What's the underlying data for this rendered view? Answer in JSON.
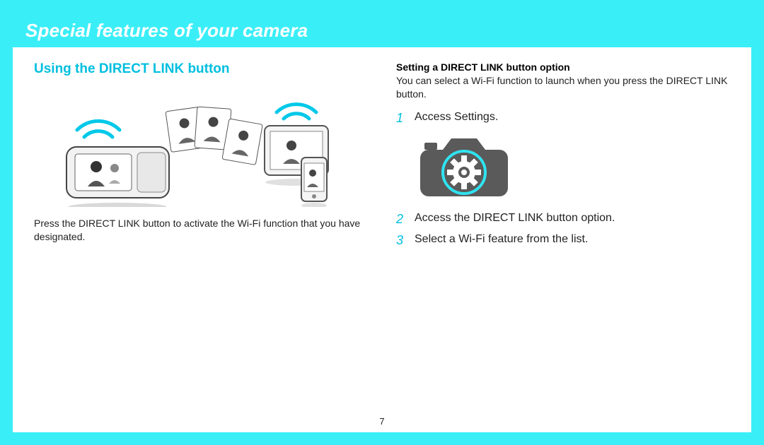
{
  "header": {
    "title": "Special features of your camera"
  },
  "left": {
    "heading": "Using the DIRECT LINK button",
    "paragraph": "Press the DIRECT LINK button to activate the Wi-Fi function that you have designated."
  },
  "right": {
    "subheading": "Setting a DIRECT LINK button option",
    "paragraph": "You can select a Wi-Fi function to launch when you press the DIRECT LINK button.",
    "steps": [
      {
        "num": "1",
        "text": "Access Settings."
      },
      {
        "num": "2",
        "text": "Access the DIRECT LINK button option."
      },
      {
        "num": "3",
        "text": "Select a Wi-Fi feature from the list."
      }
    ]
  },
  "page_number": "7"
}
